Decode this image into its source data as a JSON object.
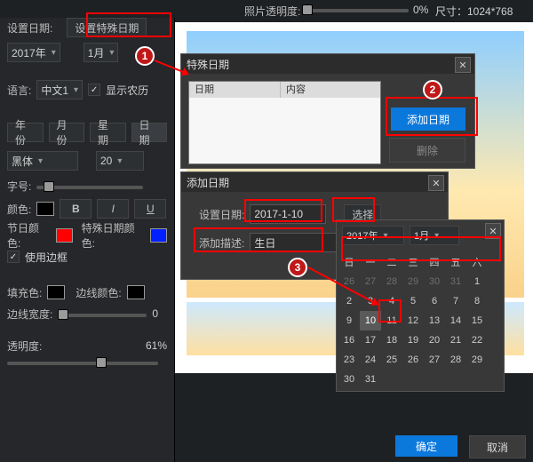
{
  "topbar": {
    "opacity_label": "照片透明度:",
    "opacity_value": "0%",
    "size_label": "尺寸：1024*768"
  },
  "left": {
    "set_date_label": "设置日期:",
    "set_special_btn": "设置特殊日期",
    "year": "2017年",
    "month": "1月",
    "lang_label": "语言:",
    "lang_value": "中文1",
    "show_lunar": "显示农历",
    "tabs": {
      "year": "年份",
      "month": "月份",
      "week": "星期",
      "day": "日期"
    },
    "font_family": "黑体",
    "font_size": "20",
    "font_size_label": "字号:",
    "style": {
      "b": "B",
      "i": "I",
      "u": "U"
    },
    "color_label": "颜色:",
    "festival_label": "节日颜色:",
    "special_label": "特殊日期颜色:",
    "use_border": "使用边框",
    "fill_label": "填充色:",
    "border_color_label": "边线颜色:",
    "border_width_label": "边线宽度:",
    "border_width_val": "0",
    "opacity_label": "透明度:",
    "opacity_val": "61%"
  },
  "special_panel": {
    "title": "特殊日期",
    "col_date": "日期",
    "col_content": "内容",
    "add_btn": "添加日期",
    "del_btn": "删除"
  },
  "add_panel": {
    "title": "添加日期",
    "set_date": "设置日期:",
    "date_value": "2017-1-10",
    "choose": "选择",
    "desc_label": "添加描述:",
    "desc_value": "生日"
  },
  "calendar": {
    "year": "2017年",
    "month": "1月",
    "dow": [
      "日",
      "一",
      "二",
      "三",
      "四",
      "五",
      "六"
    ],
    "prev_tail": [
      "26",
      "27",
      "28",
      "29",
      "30",
      "31"
    ],
    "days": [
      "1",
      "2",
      "3",
      "4",
      "5",
      "6",
      "7",
      "8",
      "9",
      "10",
      "11",
      "12",
      "13",
      "14",
      "15",
      "16",
      "17",
      "18",
      "19",
      "20",
      "21",
      "22",
      "23",
      "24",
      "25",
      "26",
      "27",
      "28",
      "29",
      "30",
      "31"
    ],
    "selected": "10"
  },
  "footer": {
    "ok": "确定",
    "cancel": "取消"
  }
}
